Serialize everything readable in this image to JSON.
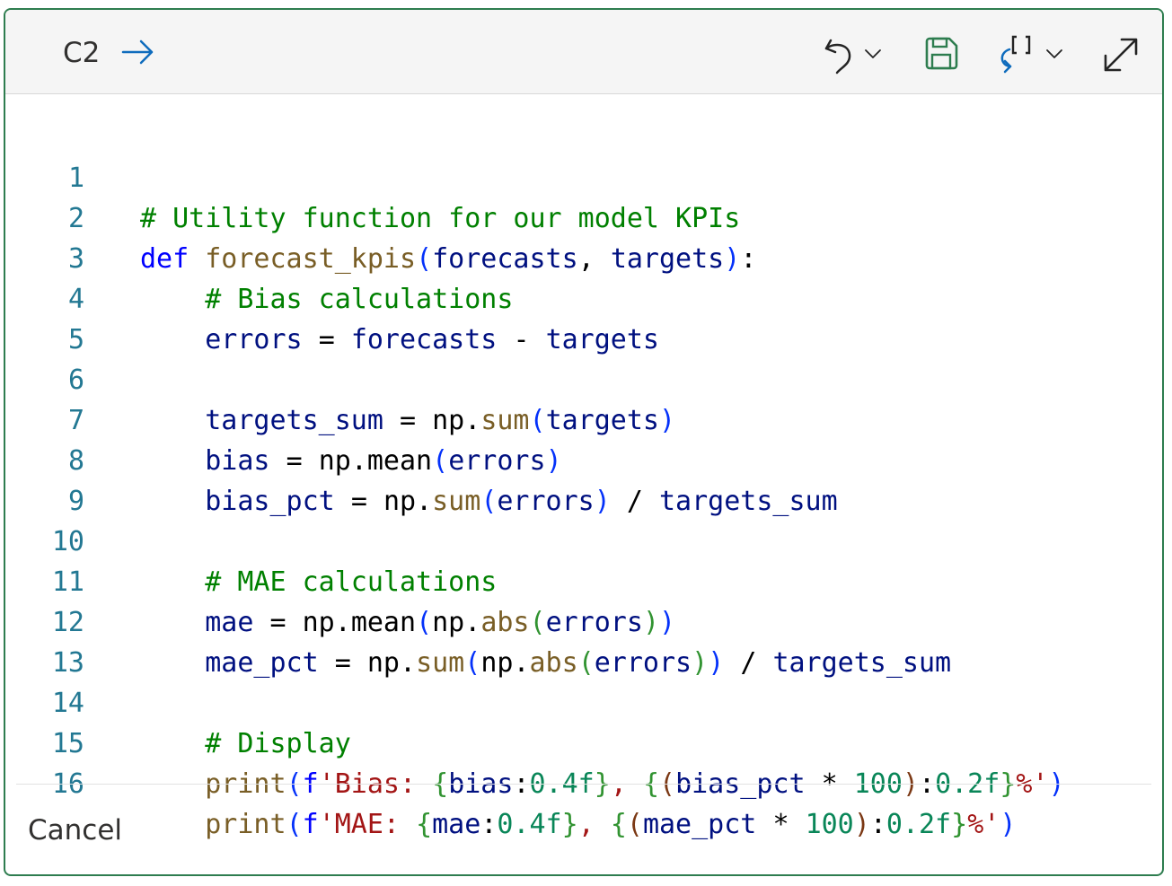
{
  "header": {
    "cell_ref": "C2",
    "icons": [
      "arrow-right-icon",
      "undo-icon",
      "chevron-down-icon",
      "save-icon",
      "formula-icon",
      "chevron-down-icon",
      "expand-icon"
    ]
  },
  "colors": {
    "border": "#2e7d4f",
    "save_icon": "#2e7d4f",
    "arrow_icon": "#0f6cbd",
    "line_number": "#237893",
    "comment": "#008000",
    "keyword": "#0000ff",
    "function": "#795e26",
    "variable": "#001080",
    "number": "#098658",
    "string": "#a31515"
  },
  "code": {
    "line_numbers": [
      "1",
      "2",
      "3",
      "4",
      "5",
      "6",
      "7",
      "8",
      "9",
      "10",
      "11",
      "12",
      "13",
      "14",
      "15",
      "16"
    ],
    "lines": [
      "# Utility function for our model KPIs",
      "def forecast_kpis(forecasts, targets):",
      "    # Bias calculations",
      "    errors = forecasts - targets",
      "",
      "    targets_sum = np.sum(targets)",
      "    bias = np.mean(errors)",
      "    bias_pct = np.sum(errors) / targets_sum",
      "",
      "    # MAE calculations",
      "    mae = np.mean(np.abs(errors))",
      "    mae_pct = np.sum(np.abs(errors)) / targets_sum",
      "",
      "    # Display",
      "    print(f'Bias: {bias:0.4f}, {(bias_pct * 100):0.2f}%')",
      "    print(f'MAE: {mae:0.4f}, {(mae_pct * 100):0.2f}%')"
    ]
  },
  "footer": {
    "cancel_label": "Cancel"
  }
}
